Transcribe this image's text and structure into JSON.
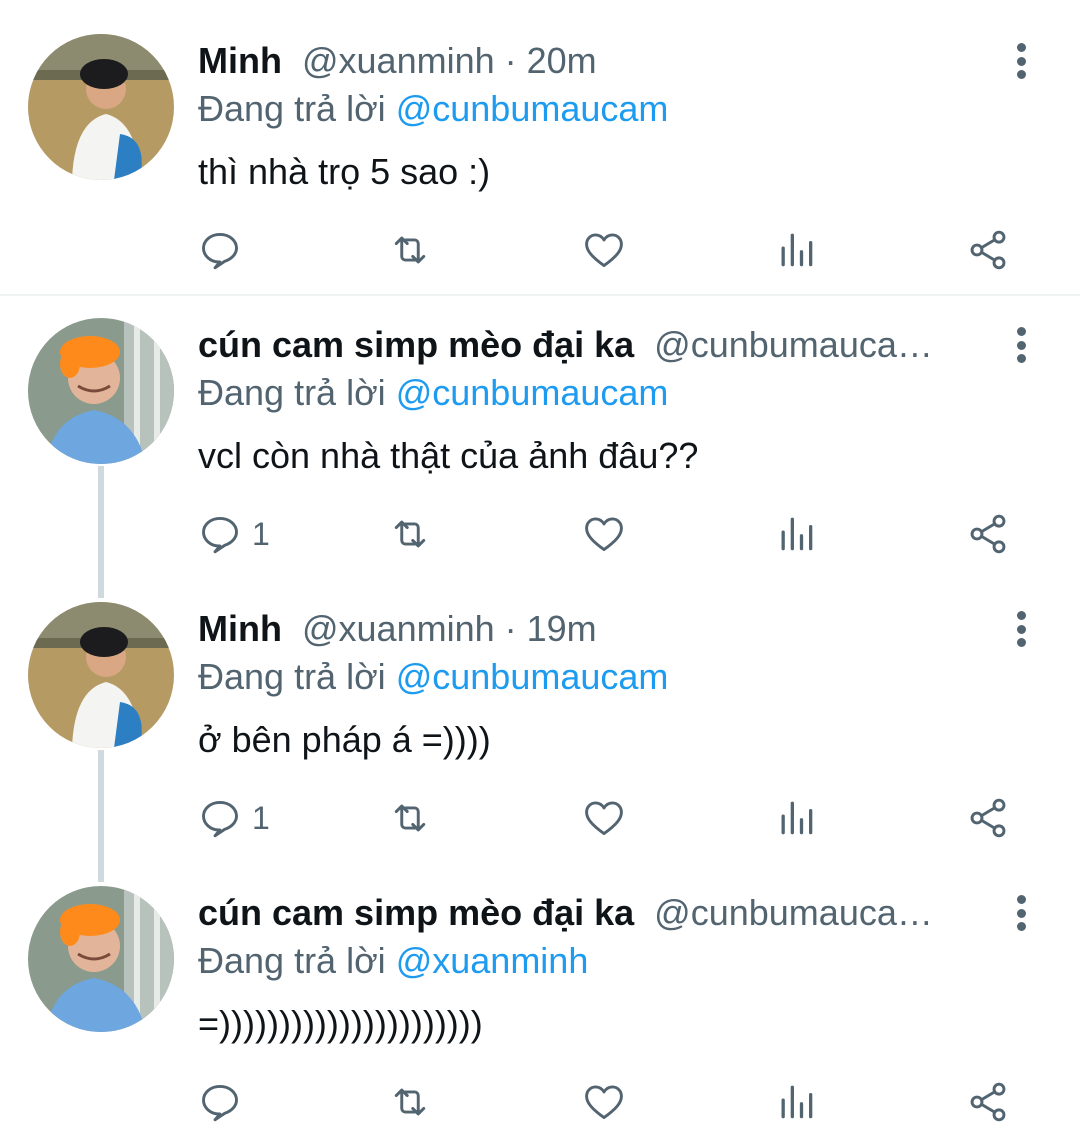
{
  "reply_prefix": "Đang trả lời",
  "colors": {
    "accent": "#1d9bf0",
    "secondary": "#536471",
    "thread_line": "#cfd9de"
  },
  "tweets": [
    {
      "name": "Minh",
      "handle": "@xuanminh",
      "separator": "·",
      "time": "20m",
      "reply_to": "@cunbumaucam",
      "text": "thì nhà trọ 5 sao :)",
      "reply_count": "",
      "avatar": "boy-dark-hair-avatar"
    },
    {
      "name": "cún cam simp mèo đại ka",
      "handle": "@cunbumauca…",
      "separator": "",
      "time": "",
      "reply_to": "@cunbumaucam",
      "text": "vcl còn nhà thật của ảnh đâu??",
      "reply_count": "1",
      "avatar": "boy-orange-hair-avatar"
    },
    {
      "name": "Minh",
      "handle": "@xuanminh",
      "separator": "·",
      "time": "19m",
      "reply_to": "@cunbumaucam",
      "text": "ở bên pháp á =))))",
      "reply_count": "1",
      "avatar": "boy-dark-hair-avatar"
    },
    {
      "name": "cún cam simp mèo đại ka",
      "handle": "@cunbumauca…",
      "separator": "",
      "time": "",
      "reply_to": "@xuanminh",
      "text": "=))))))))))))))))))))))",
      "reply_count": "",
      "avatar": "boy-orange-hair-avatar"
    }
  ]
}
